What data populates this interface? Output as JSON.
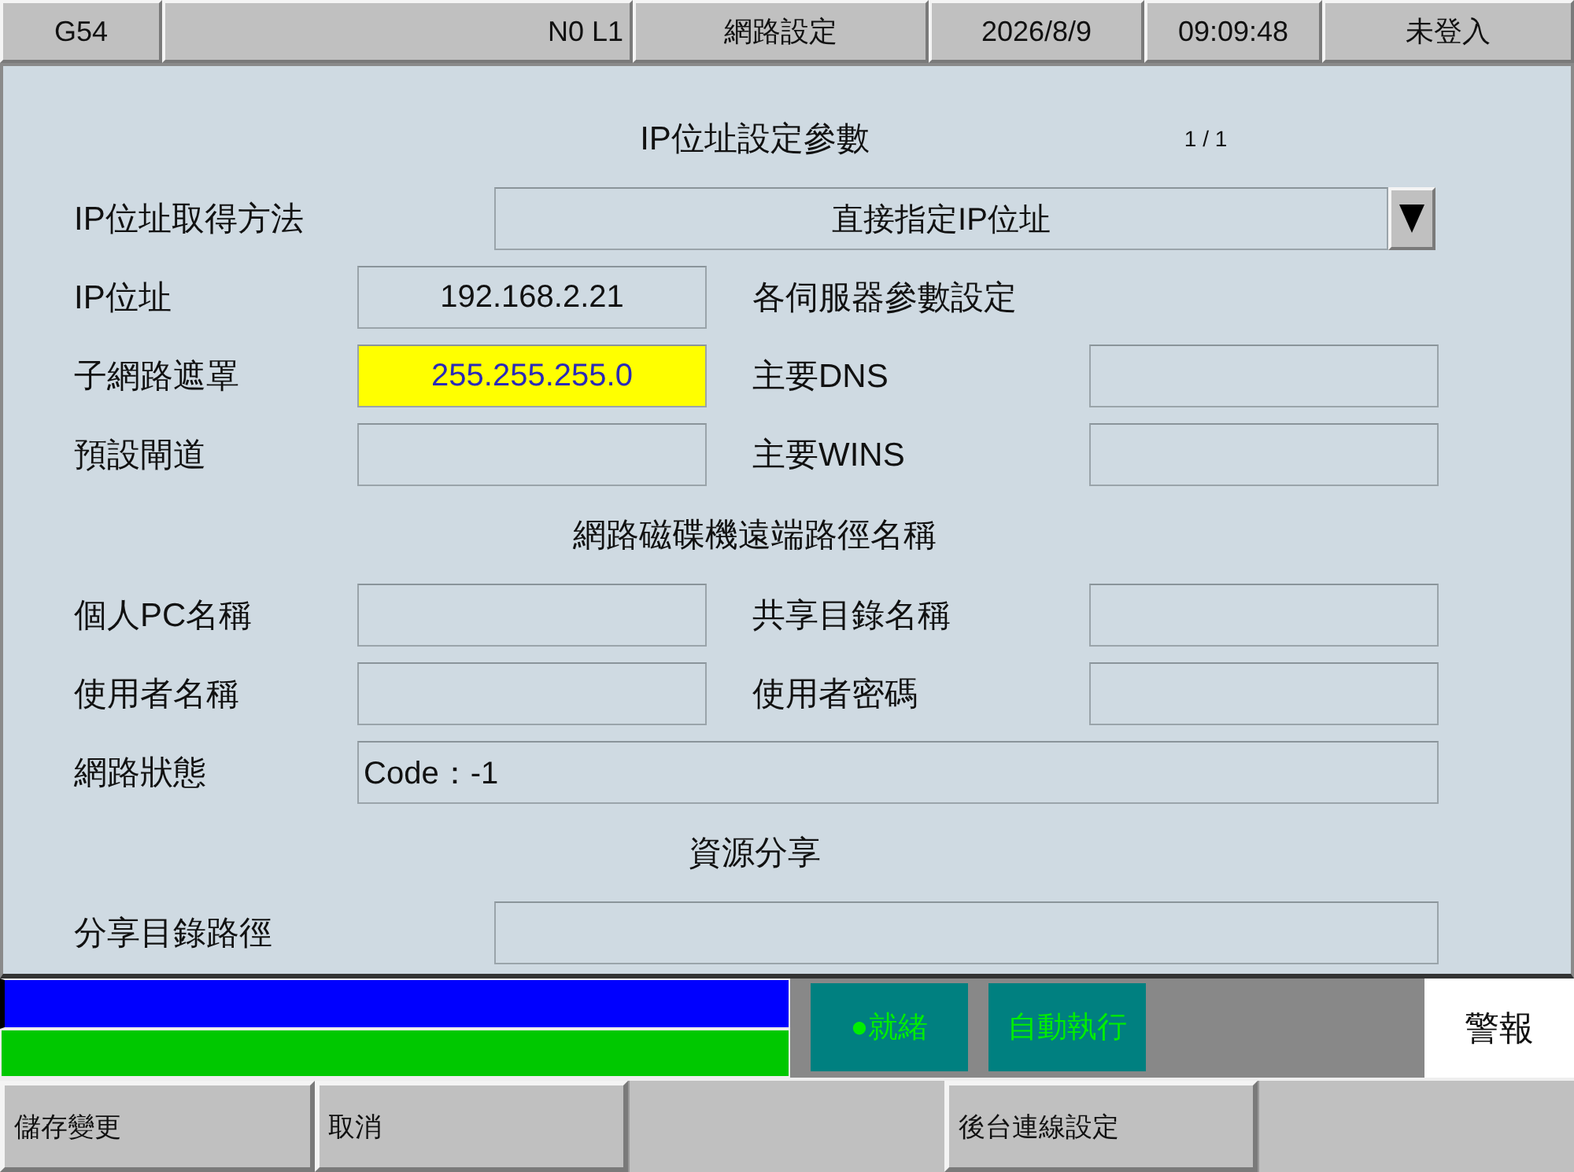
{
  "header": {
    "cells": [
      {
        "text": "G54"
      },
      {
        "text": "N0 L1"
      },
      {
        "text": "網路設定"
      },
      {
        "text": "2026/8/9"
      },
      {
        "text": "09:09:48"
      },
      {
        "text": "未登入"
      }
    ]
  },
  "form": {
    "rows": [
      {
        "kind": "heading",
        "text": "IP位址設定參數",
        "page": "1 / 1"
      },
      {
        "kind": "select",
        "label": "IP位址取得方法",
        "value": "直接指定IP位址"
      },
      {
        "kind": "pair",
        "left": {
          "label": "IP位址",
          "value": "192.168.2.21",
          "focused": false
        },
        "right": {
          "kind": "text",
          "text": "各伺服器參數設定"
        }
      },
      {
        "kind": "pair",
        "left": {
          "label": "子網路遮罩",
          "value": "255.255.255.0",
          "focused": true
        },
        "right": {
          "kind": "field",
          "label": "主要DNS",
          "focused": false
        }
      },
      {
        "kind": "pair",
        "left": {
          "label": "預設閘道",
          "focused": false
        },
        "right": {
          "kind": "field",
          "label": "主要WINS",
          "focused": false
        }
      },
      {
        "kind": "heading",
        "text": "網路磁碟機遠端路徑名稱"
      },
      {
        "kind": "pair",
        "left": {
          "label": "個人PC名稱",
          "focused": false
        },
        "right": {
          "kind": "field",
          "label": "共享目錄名稱",
          "focused": false
        }
      },
      {
        "kind": "pair",
        "left": {
          "label": "使用者名稱",
          "focused": false
        },
        "right": {
          "kind": "field",
          "label": "使用者密碼",
          "focused": false
        }
      },
      {
        "kind": "wide",
        "label": "網路狀態",
        "value": "Code：-1",
        "focused": false
      },
      {
        "kind": "heading",
        "text": "資源分享"
      },
      {
        "kind": "path",
        "label": "分享目錄路徑",
        "focused": false
      }
    ]
  },
  "status": {
    "indicators": [
      {
        "text": "●就緒"
      },
      {
        "text": "自動執行"
      }
    ],
    "alarm": "警報"
  },
  "softkeys": [
    {
      "kind": "button",
      "label": "儲存變更"
    },
    {
      "kind": "button",
      "label": "取消"
    },
    {
      "kind": "blank"
    },
    {
      "kind": "button",
      "label": "後台連線設定"
    },
    {
      "kind": "blank"
    }
  ]
}
